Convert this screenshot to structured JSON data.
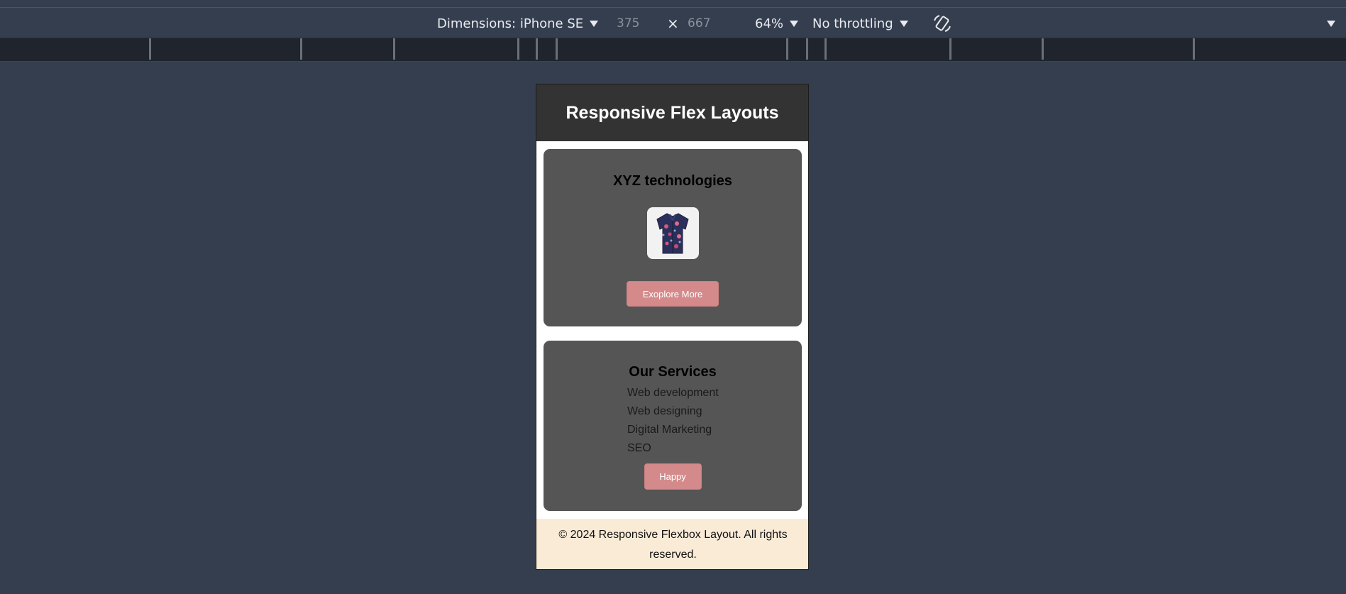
{
  "devtools": {
    "dimensions_label": "Dimensions: iPhone SE",
    "width_value": "375",
    "times_symbol": "×",
    "height_value": "667",
    "zoom": "64%",
    "throttling": "No throttling"
  },
  "page": {
    "header_title": "Responsive Flex Layouts",
    "company_card": {
      "title": "XYZ technologies",
      "button_label": "Exoplore More"
    },
    "services_card": {
      "title": "Our Services",
      "items": [
        "Web development",
        "Web designing",
        "Digital Marketing",
        "SEO"
      ],
      "button_label": "Happy"
    },
    "footer_text": "© 2024 Responsive Flexbox Layout. All rights reserved."
  },
  "colors": {
    "header_bg": "#333333",
    "card_bg": "#555555",
    "button_bg": "#d48a8a",
    "footer_bg": "#faebd7",
    "devtools_bg": "#343e4f"
  }
}
